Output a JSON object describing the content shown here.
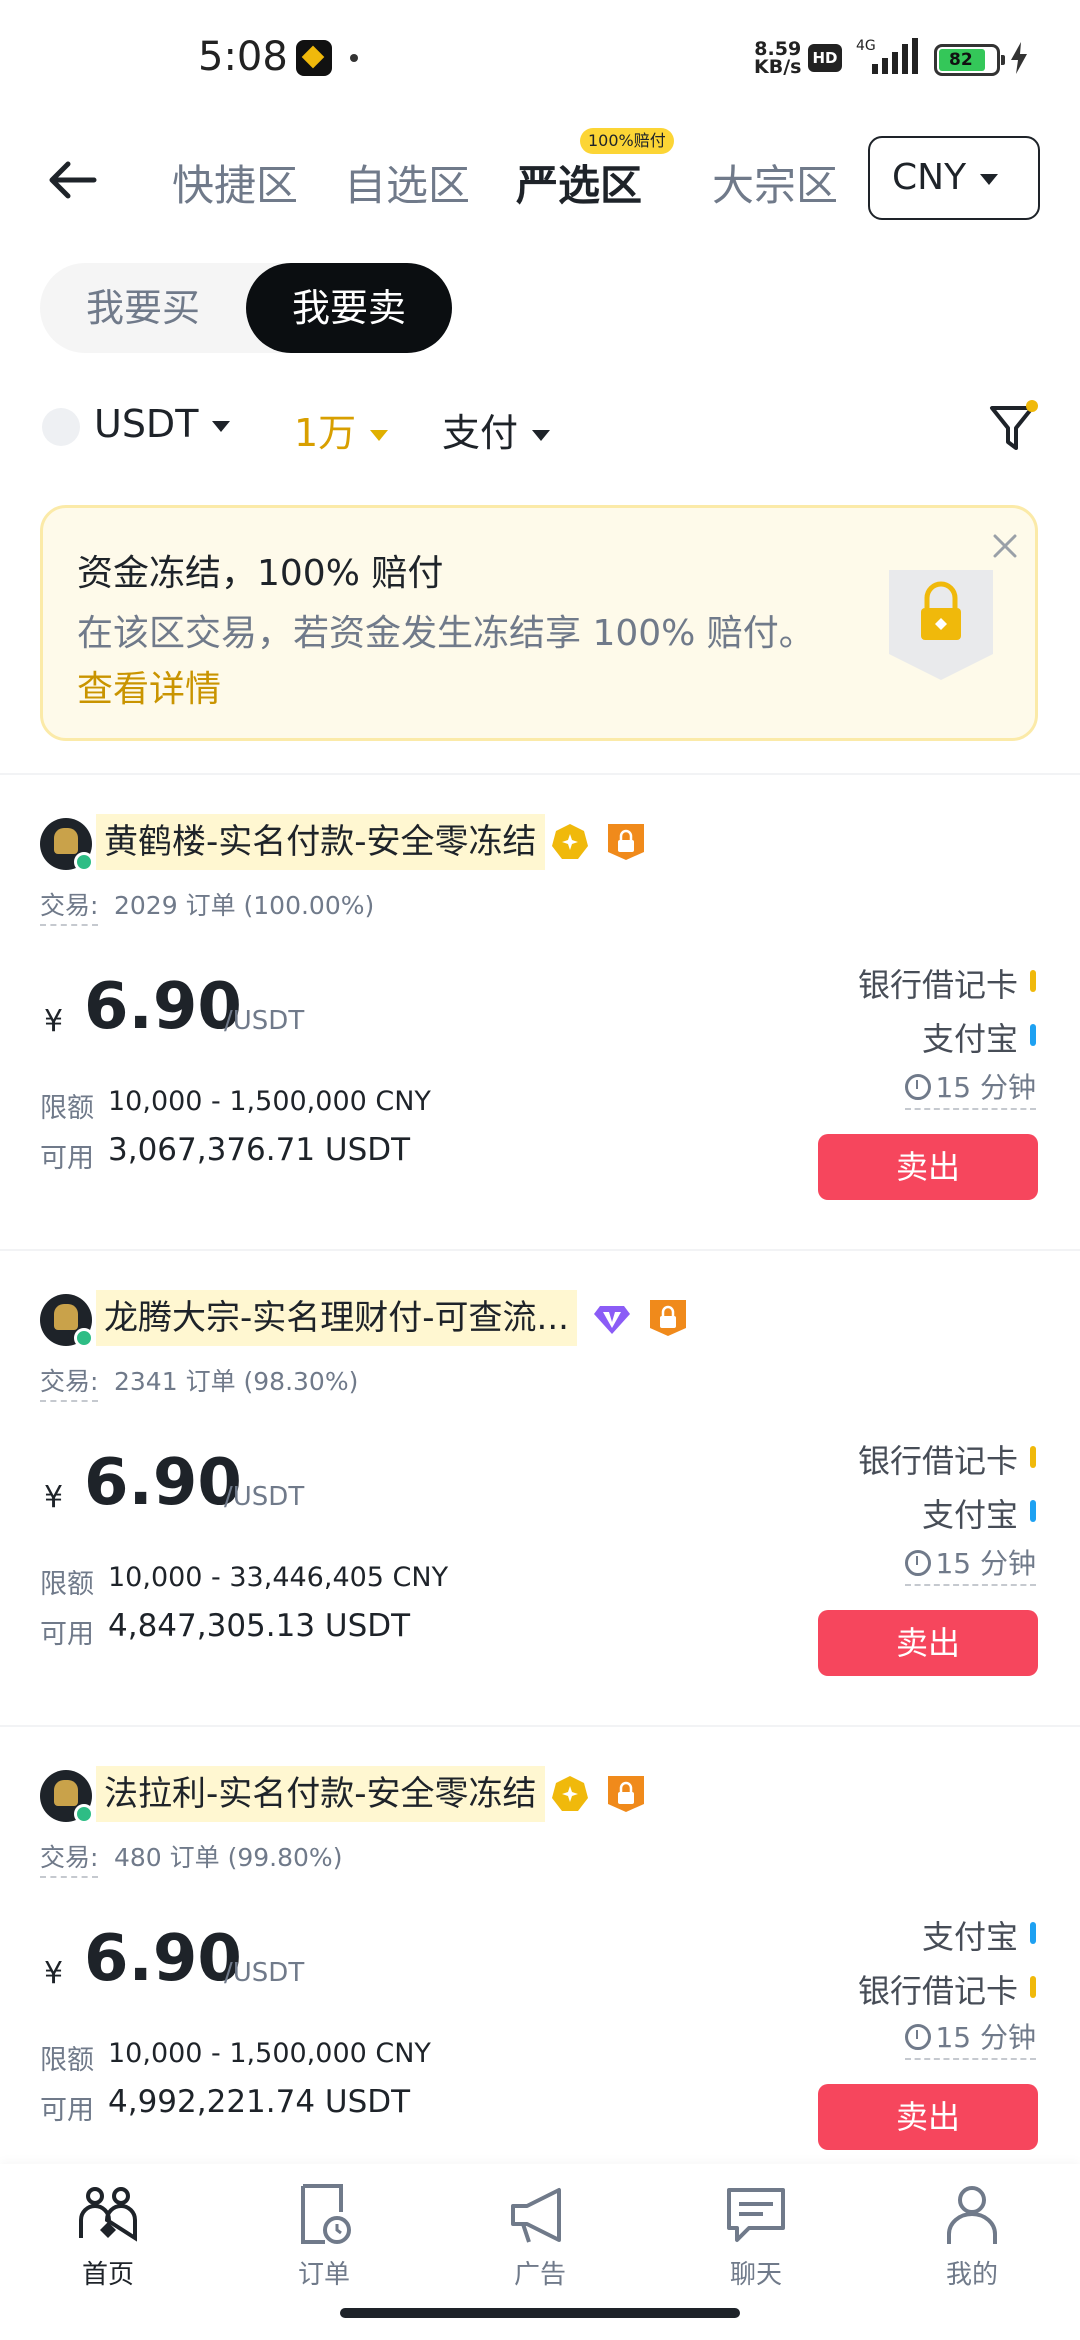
{
  "status_bar": {
    "time": "5:08",
    "net_speed_value": "8.59",
    "net_speed_unit": "KB/s",
    "hd": "HD",
    "network": "4G",
    "battery": "82"
  },
  "nav": {
    "tabs": [
      {
        "label": "快捷区",
        "active": false
      },
      {
        "label": "自选区",
        "active": false
      },
      {
        "label": "严选区",
        "active": true
      },
      {
        "label": "大宗区",
        "active": false
      }
    ],
    "tab_badge": "100%赔付",
    "currency": "CNY"
  },
  "toggle": {
    "buy": "我要买",
    "sell": "我要卖",
    "selected": "sell"
  },
  "filters": {
    "coin": "USDT",
    "amount": "1万",
    "payment": "支付"
  },
  "promo": {
    "title": "资金冻结，100% 赔付",
    "description": "在该区交易，若资金发生冻结享 100% 赔付。",
    "link": "查看详情"
  },
  "ads": [
    {
      "merchant": "黄鹤楼-实名付款-安全零冻结",
      "badge": "gold",
      "trades_label": "交易:",
      "trades_value": "2029 订单 (100.00%)",
      "currency_symbol": "¥",
      "price": "6.90",
      "price_unit": "/USDT",
      "limit_label": "限额",
      "limit": "10,000 - 1,500,000 CNY",
      "available_label": "可用",
      "available": "3,067,376.71 USDT",
      "payments": [
        {
          "name": "银行借记卡",
          "color": "#f0b90b"
        },
        {
          "name": "支付宝",
          "color": "#1ea1f2"
        }
      ],
      "time_limit": "15 分钟",
      "action": "卖出"
    },
    {
      "merchant": "龙腾大宗-实名理财付-可查流...",
      "badge": "purple",
      "trades_label": "交易:",
      "trades_value": "2341 订单 (98.30%)",
      "currency_symbol": "¥",
      "price": "6.90",
      "price_unit": "/USDT",
      "limit_label": "限额",
      "limit": "10,000 - 33,446,405 CNY",
      "available_label": "可用",
      "available": "4,847,305.13 USDT",
      "payments": [
        {
          "name": "银行借记卡",
          "color": "#f0b90b"
        },
        {
          "name": "支付宝",
          "color": "#1ea1f2"
        }
      ],
      "time_limit": "15 分钟",
      "action": "卖出"
    },
    {
      "merchant": "法拉利-实名付款-安全零冻结",
      "badge": "gold",
      "trades_label": "交易:",
      "trades_value": "480 订单 (99.80%)",
      "currency_symbol": "¥",
      "price": "6.90",
      "price_unit": "/USDT",
      "limit_label": "限额",
      "limit": "10,000 - 1,500,000 CNY",
      "available_label": "可用",
      "available": "4,992,221.74 USDT",
      "payments": [
        {
          "name": "支付宝",
          "color": "#1ea1f2"
        },
        {
          "name": "银行借记卡",
          "color": "#f0b90b"
        }
      ],
      "time_limit": "15 分钟",
      "action": "卖出"
    }
  ],
  "bottom_nav": [
    {
      "label": "首页",
      "icon": "home-icon",
      "active": true
    },
    {
      "label": "订单",
      "icon": "orders-icon",
      "active": false
    },
    {
      "label": "广告",
      "icon": "megaphone-icon",
      "active": false
    },
    {
      "label": "聊天",
      "icon": "chat-icon",
      "active": false
    },
    {
      "label": "我的",
      "icon": "profile-icon",
      "active": false
    }
  ],
  "colors": {
    "brand_yellow": "#f0b90b",
    "sell_red": "#f6465d",
    "online_green": "#2ebd85",
    "gold_text": "#c99400"
  }
}
